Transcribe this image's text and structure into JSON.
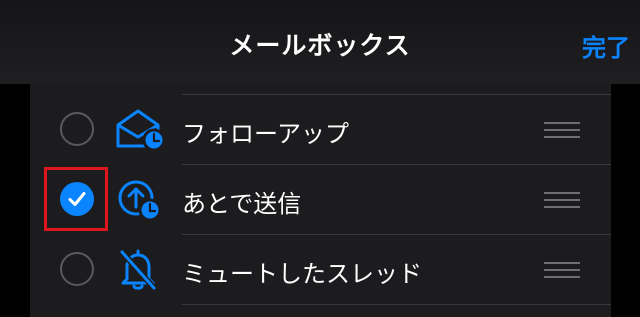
{
  "header": {
    "title": "メールボックス",
    "done_label": "完了"
  },
  "mailboxes": [
    {
      "label": "フォローアップ",
      "icon": "envelope-clock-icon",
      "selected": false
    },
    {
      "label": "あとで送信",
      "icon": "send-later-clock-icon",
      "selected": true
    },
    {
      "label": "ミュートしたスレッド",
      "icon": "bell-slash-icon",
      "selected": false
    }
  ],
  "colors": {
    "accent": "#0a84ff",
    "highlight_box": "#e0161e",
    "background": "#000000",
    "row_background": "#1c1c1e"
  }
}
